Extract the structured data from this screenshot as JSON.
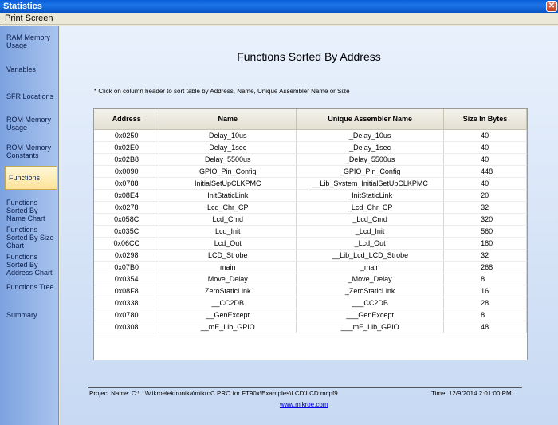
{
  "window": {
    "title": "Statistics",
    "close_glyph": "✕"
  },
  "menu": {
    "items": [
      {
        "label": "Print Screen"
      }
    ]
  },
  "sidebar": {
    "items": [
      {
        "label": "RAM Memory Usage"
      },
      {
        "label": "Variables"
      },
      {
        "label": "SFR Locations"
      },
      {
        "label": "ROM Memory Usage"
      },
      {
        "label": "ROM Memory Constants"
      },
      {
        "label": "Functions",
        "active": true
      },
      {
        "label": "Functions Sorted By Name Chart"
      },
      {
        "label": "Functions Sorted By Size Chart"
      },
      {
        "label": "Functions Sorted By Address Chart"
      },
      {
        "label": "Functions Tree"
      },
      {
        "label": "Summary"
      }
    ]
  },
  "main": {
    "heading": "Functions Sorted By Address",
    "hint": "* Click on column header to sort table by Address, Name, Unique Assembler Name or Size",
    "table": {
      "headers": [
        "Address",
        "Name",
        "Unique Assembler Name",
        "Size In Bytes"
      ],
      "rows": [
        [
          "0x0250",
          "Delay_10us",
          "_Delay_10us",
          "40"
        ],
        [
          "0x02E0",
          "Delay_1sec",
          "_Delay_1sec",
          "40"
        ],
        [
          "0x02B8",
          "Delay_5500us",
          "_Delay_5500us",
          "40"
        ],
        [
          "0x0090",
          "GPIO_Pin_Config",
          "_GPIO_Pin_Config",
          "448"
        ],
        [
          "0x0788",
          "InitialSetUpCLKPMC",
          "__Lib_System_InitialSetUpCLKPMC",
          "40"
        ],
        [
          "0x08E4",
          "InitStaticLink",
          "_InitStaticLink",
          "20"
        ],
        [
          "0x0278",
          "Lcd_Chr_CP",
          "_Lcd_Chr_CP",
          "32"
        ],
        [
          "0x058C",
          "Lcd_Cmd",
          "_Lcd_Cmd",
          "320"
        ],
        [
          "0x035C",
          "Lcd_Init",
          "_Lcd_Init",
          "560"
        ],
        [
          "0x06CC",
          "Lcd_Out",
          "_Lcd_Out",
          "180"
        ],
        [
          "0x0298",
          "LCD_Strobe",
          "__Lib_Lcd_LCD_Strobe",
          "32"
        ],
        [
          "0x07B0",
          "main",
          "_main",
          "268"
        ],
        [
          "0x0354",
          "Move_Delay",
          "_Move_Delay",
          "8"
        ],
        [
          "0x08F8",
          "ZeroStaticLink",
          "_ZeroStaticLink",
          "16"
        ],
        [
          "0x0338",
          "__CC2DB",
          "___CC2DB",
          "28"
        ],
        [
          "0x0780",
          "__GenExcept",
          "___GenExcept",
          "8"
        ],
        [
          "0x0308",
          "__mE_Lib_GPIO",
          "___mE_Lib_GPIO",
          "48"
        ]
      ]
    },
    "footer": {
      "project": "Project Name: C:\\...\\Mikroelektronika\\mikroC PRO for FT90x\\Examples\\LCD\\LCD.mcpf9",
      "time": "Time: 12/9/2014 2:01:00 PM",
      "link": "www.mikroe.com"
    }
  }
}
